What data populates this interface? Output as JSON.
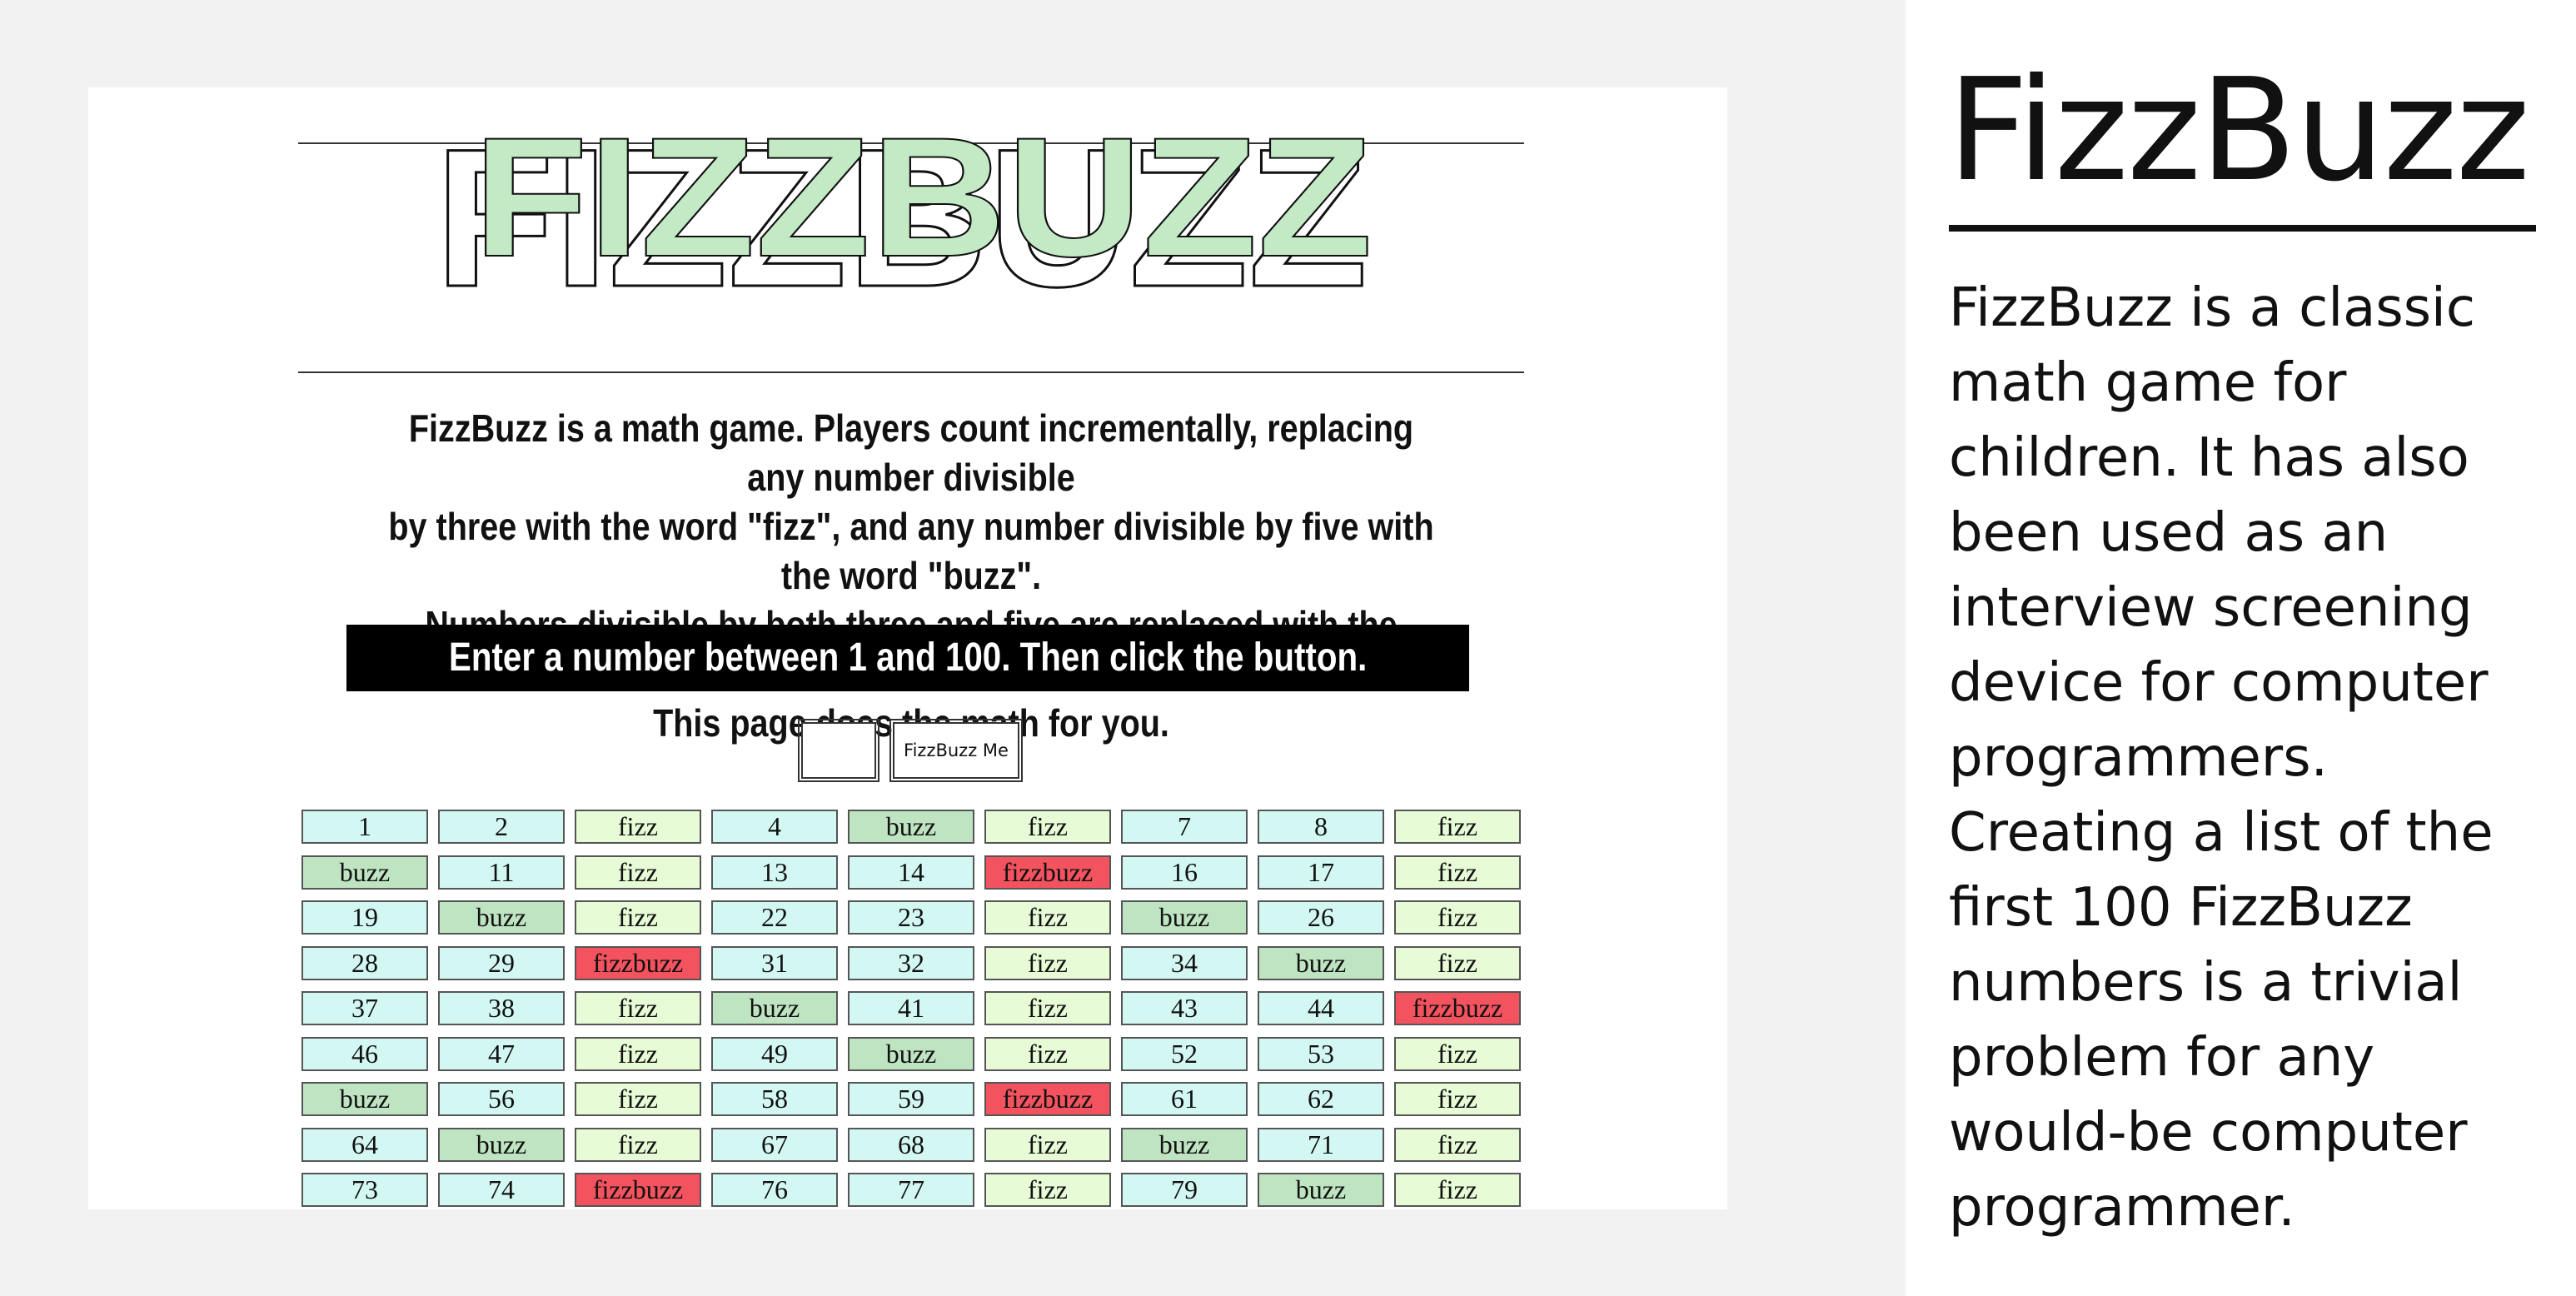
{
  "right_panel": {
    "title": "FizzBuzz",
    "description": "FizzBuzz is a classic math game for children. It has also been used as an interview screening device for computer programmers. Creating a list of the first 100 FizzBuzz numbers is a trivial problem for any would-be computer programmer."
  },
  "page": {
    "logo_text": "FIZZBUZZ",
    "intro_lines": [
      "FizzBuzz is a math game. Players count incrementally, replacing any number divisible",
      "by three with the word \"fizz\", and any number divisible by five with the word \"buzz\".",
      "Numbers divisible by both three and five are replaced with the word \"fizzbuzz\".",
      "This page does the math for you."
    ],
    "prompt": "Enter a number between 1 and 100. Then click the button.",
    "input_value": "",
    "button_label": "FizzBuzz Me"
  },
  "colors": {
    "number": "#d3f8f4",
    "fizz": "#e6fbd6",
    "buzz": "#bfe4c2",
    "fizzbuzz": "#f2535f"
  },
  "results": [
    "1",
    "2",
    "fizz",
    "4",
    "buzz",
    "fizz",
    "7",
    "8",
    "fizz",
    "buzz",
    "11",
    "fizz",
    "13",
    "14",
    "fizzbuzz",
    "16",
    "17",
    "fizz",
    "19",
    "buzz",
    "fizz",
    "22",
    "23",
    "fizz",
    "buzz",
    "26",
    "fizz",
    "28",
    "29",
    "fizzbuzz",
    "31",
    "32",
    "fizz",
    "34",
    "buzz",
    "fizz",
    "37",
    "38",
    "fizz",
    "buzz",
    "41",
    "fizz",
    "43",
    "44",
    "fizzbuzz",
    "46",
    "47",
    "fizz",
    "49",
    "buzz",
    "fizz",
    "52",
    "53",
    "fizz",
    "buzz",
    "56",
    "fizz",
    "58",
    "59",
    "fizzbuzz",
    "61",
    "62",
    "fizz",
    "64",
    "buzz",
    "fizz",
    "67",
    "68",
    "fizz",
    "buzz",
    "71",
    "fizz",
    "73",
    "74",
    "fizzbuzz",
    "76",
    "77",
    "fizz",
    "79",
    "buzz",
    "fizz"
  ]
}
